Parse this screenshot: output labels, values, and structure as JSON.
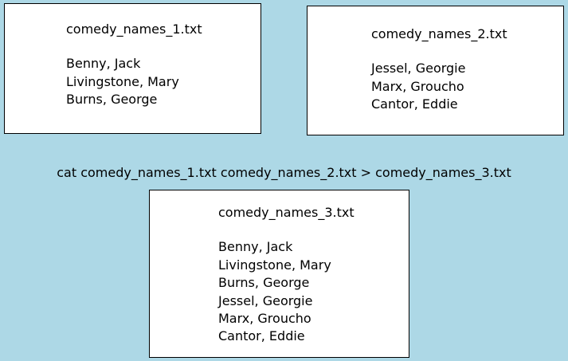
{
  "diagram": {
    "command": "cat comedy_names_1.txt comedy_names_2.txt > comedy_names_3.txt",
    "files": [
      {
        "title": "comedy_names_1.txt",
        "lines": [
          "Benny, Jack",
          "Livingstone, Mary",
          "Burns, George"
        ]
      },
      {
        "title": "comedy_names_2.txt",
        "lines": [
          "Jessel, Georgie",
          "Marx, Groucho",
          "Cantor, Eddie"
        ]
      },
      {
        "title": "comedy_names_3.txt",
        "lines": [
          "Benny, Jack",
          "Livingstone, Mary",
          "Burns, George",
          "Jessel, Georgie",
          "Marx, Groucho",
          "Cantor, Eddie"
        ]
      }
    ]
  },
  "colors": {
    "background": "#add8e6",
    "box_fill": "#ffffff",
    "box_border": "#000000"
  }
}
